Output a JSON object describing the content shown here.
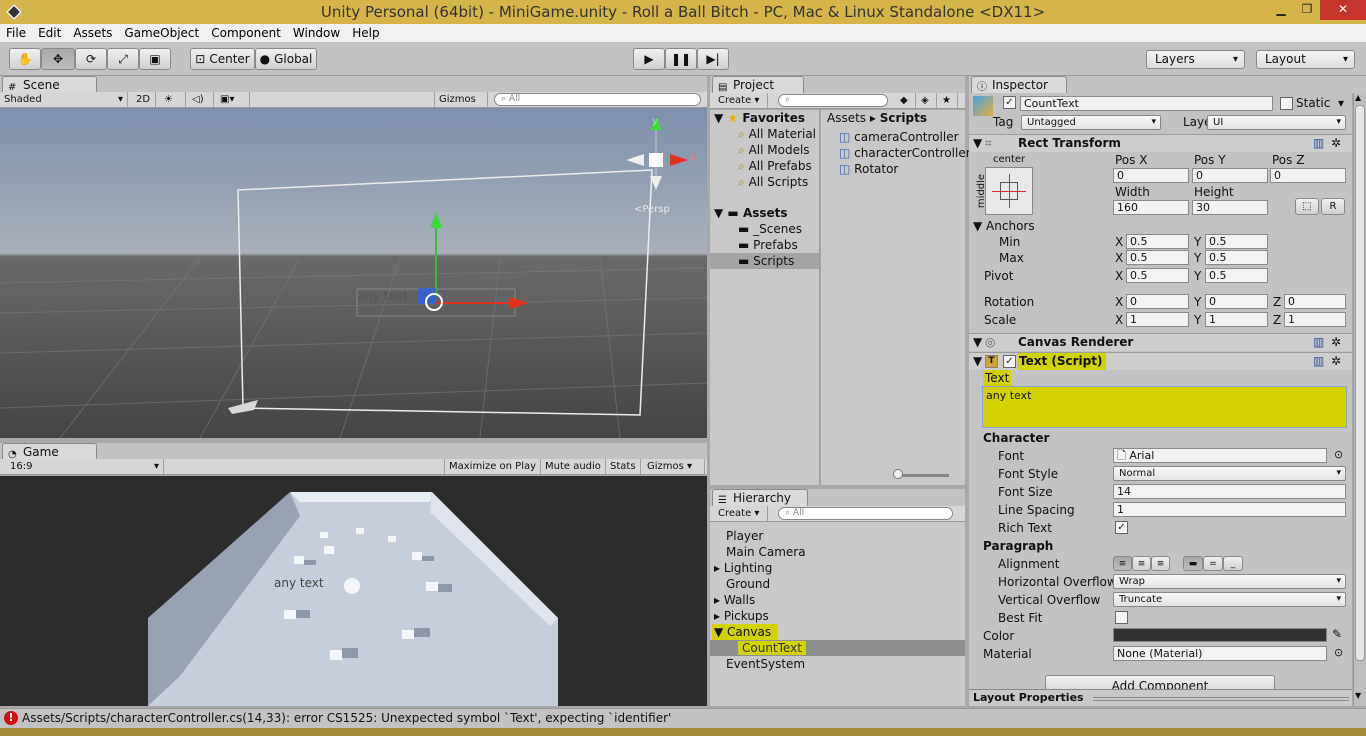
{
  "window": {
    "title": "Unity Personal (64bit) - MiniGame.unity - Roll a Ball Bitch - PC, Mac & Linux Standalone <DX11>",
    "minimize": "▁",
    "restore": "❐",
    "close": "✕"
  },
  "menu": [
    "File",
    "Edit",
    "Assets",
    "GameObject",
    "Component",
    "Window",
    "Help"
  ],
  "toolbar": {
    "pivot": "Center",
    "space": "Global",
    "layers": "Layers",
    "layout": "Layout"
  },
  "scene": {
    "tab": "Scene",
    "shading": "Shaded",
    "mode_2d": "2D",
    "gizmos": "Gizmos",
    "search_placeholder": "All",
    "text_label": "any text",
    "persp": "<Persp",
    "axis_y": "y",
    "axis_x": "x"
  },
  "game": {
    "tab": "Game",
    "aspect": "16:9",
    "maximize": "Maximize on Play",
    "mute": "Mute audio",
    "stats": "Stats",
    "gizmos": "Gizmos",
    "text_label": "any text"
  },
  "project": {
    "tab": "Project",
    "create": "Create",
    "favorites_label": "Favorites",
    "favorites": [
      "All Material",
      "All Models",
      "All Prefabs",
      "All Scripts"
    ],
    "assets_label": "Assets",
    "folders": [
      "_Scenes",
      "Prefabs",
      "Scripts"
    ],
    "breadcrumb": [
      "Assets",
      "Scripts"
    ],
    "files": [
      "cameraController",
      "characterController",
      "Rotator"
    ]
  },
  "hierarchy": {
    "tab": "Hierarchy",
    "create": "Create",
    "search_placeholder": "All",
    "items": [
      "Player",
      "Main Camera",
      "Lighting",
      "Ground",
      "Walls",
      "Pickups",
      "Canvas",
      "CountText",
      "EventSystem"
    ]
  },
  "inspector": {
    "tab": "Inspector",
    "name": "CountText",
    "static_label": "Static",
    "tag_label": "Tag",
    "tag_value": "Untagged",
    "layer_label": "Layer",
    "layer_value": "UI",
    "rect_transform": {
      "title": "Rect Transform",
      "anchor_h": "center",
      "anchor_v": "middle",
      "pos_x_label": "Pos X",
      "pos_y_label": "Pos Y",
      "pos_z_label": "Pos Z",
      "pos_x": "0",
      "pos_y": "0",
      "pos_z": "0",
      "width_label": "Width",
      "height_label": "Height",
      "width": "160",
      "height": "30",
      "r_button": "R",
      "anchors_label": "Anchors",
      "min_label": "Min",
      "max_label": "Max",
      "min_x": "0.5",
      "min_y": "0.5",
      "max_x": "0.5",
      "max_y": "0.5",
      "pivot_label": "Pivot",
      "pivot_x": "0.5",
      "pivot_y": "0.5",
      "rotation_label": "Rotation",
      "rot_x": "0",
      "rot_y": "0",
      "rot_z": "0",
      "scale_label": "Scale",
      "scale_x": "1",
      "scale_y": "1",
      "scale_z": "1",
      "x": "X",
      "y": "Y",
      "z": "Z"
    },
    "canvas_renderer": {
      "title": "Canvas Renderer"
    },
    "text_script": {
      "title": "Text (Script)",
      "text_label": "Text",
      "text_value": "any text",
      "character_label": "Character",
      "font_label": "Font",
      "font_value": "Arial",
      "font_style_label": "Font Style",
      "font_style_value": "Normal",
      "font_size_label": "Font Size",
      "font_size_value": "14",
      "line_spacing_label": "Line Spacing",
      "line_spacing_value": "1",
      "rich_text_label": "Rich Text",
      "paragraph_label": "Paragraph",
      "alignment_label": "Alignment",
      "h_overflow_label": "Horizontal Overflow",
      "h_overflow_value": "Wrap",
      "v_overflow_label": "Vertical Overflow",
      "v_overflow_value": "Truncate",
      "best_fit_label": "Best Fit",
      "color_label": "Color",
      "material_label": "Material",
      "material_value": "None (Material)"
    },
    "add_component": "Add Component",
    "layout_properties": "Layout Properties"
  },
  "status": {
    "error": "Assets/Scripts/characterController.cs(14,33): error CS1525: Unexpected symbol `Text', expecting `identifier'"
  },
  "colors": {
    "titlebar": "#d4b54a",
    "highlight": "#d3d100",
    "error": "#d01010"
  }
}
